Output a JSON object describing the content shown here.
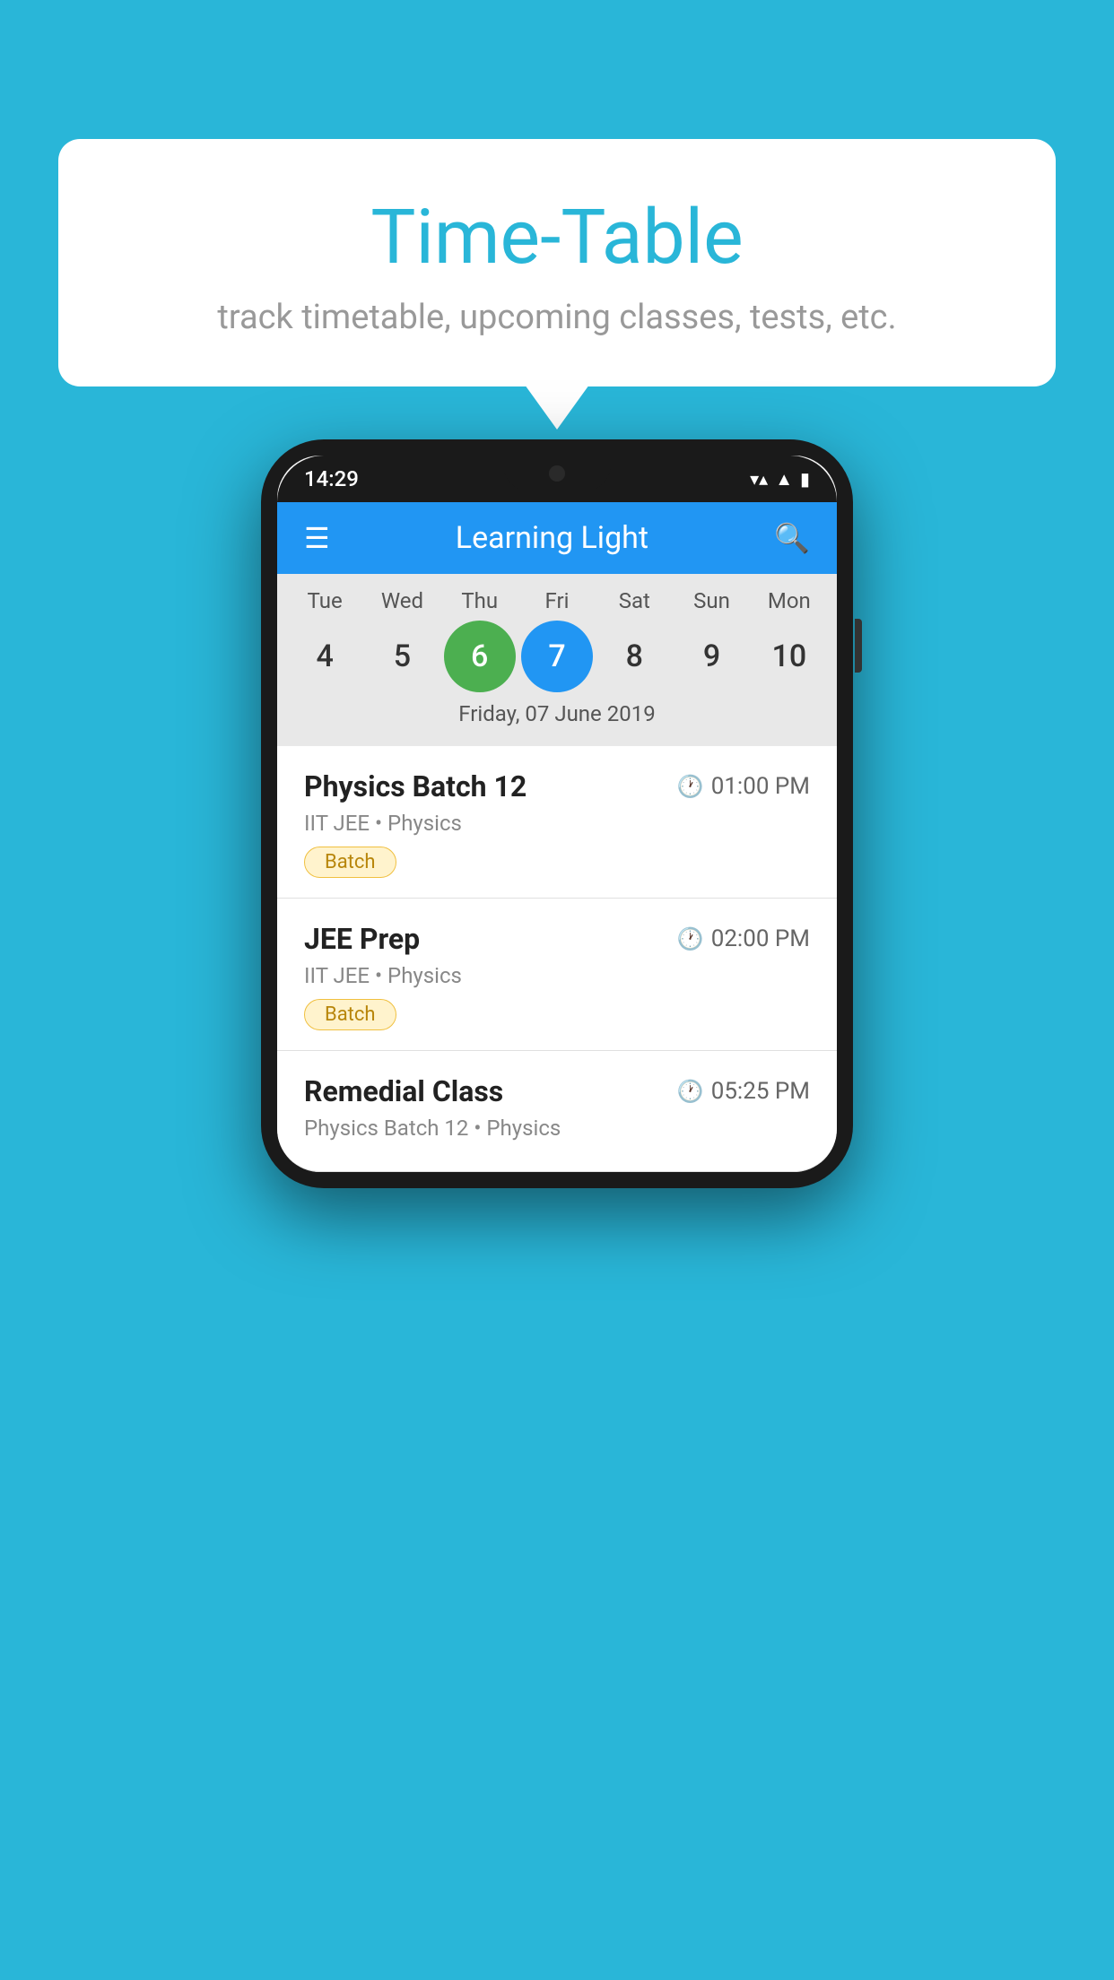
{
  "background": {
    "color": "#29b6d8"
  },
  "speech_bubble": {
    "title": "Time-Table",
    "subtitle": "track timetable, upcoming classes, tests, etc."
  },
  "phone": {
    "status_bar": {
      "time": "14:29",
      "icons": [
        "wifi",
        "signal",
        "battery"
      ]
    },
    "app_header": {
      "title": "Learning Light",
      "menu_icon": "☰",
      "search_icon": "🔍"
    },
    "calendar": {
      "days": [
        {
          "label": "Tue",
          "num": "4"
        },
        {
          "label": "Wed",
          "num": "5"
        },
        {
          "label": "Thu",
          "num": "6",
          "state": "today"
        },
        {
          "label": "Fri",
          "num": "7",
          "state": "selected"
        },
        {
          "label": "Sat",
          "num": "8"
        },
        {
          "label": "Sun",
          "num": "9"
        },
        {
          "label": "Mon",
          "num": "10"
        }
      ],
      "selected_date": "Friday, 07 June 2019"
    },
    "classes": [
      {
        "name": "Physics Batch 12",
        "time": "01:00 PM",
        "meta": "IIT JEE • Physics",
        "badge": "Batch"
      },
      {
        "name": "JEE Prep",
        "time": "02:00 PM",
        "meta": "IIT JEE • Physics",
        "badge": "Batch"
      },
      {
        "name": "Remedial Class",
        "time": "05:25 PM",
        "meta": "Physics Batch 12 • Physics",
        "badge": ""
      }
    ]
  }
}
